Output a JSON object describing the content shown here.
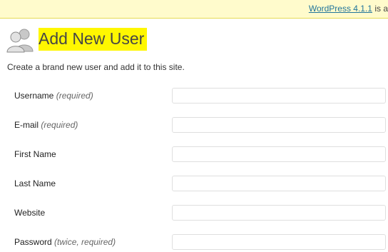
{
  "notice": {
    "link_text": "WordPress 4.1.1",
    "suffix_text": " is a"
  },
  "header": {
    "title": "Add New User",
    "icon": "users-icon"
  },
  "intro_text": "Create a brand new user and add it to this site.",
  "form": {
    "fields": [
      {
        "label": "Username",
        "hint": "(required)",
        "value": ""
      },
      {
        "label": "E-mail",
        "hint": "(required)",
        "value": ""
      },
      {
        "label": "First Name",
        "hint": "",
        "value": ""
      },
      {
        "label": "Last Name",
        "hint": "",
        "value": ""
      },
      {
        "label": "Website",
        "hint": "",
        "value": ""
      },
      {
        "label": "Password",
        "hint": "(twice, required)",
        "value": ""
      }
    ]
  },
  "colors": {
    "notice_bg": "#fffbcc",
    "highlight": "#fff700",
    "link": "#21759b"
  }
}
